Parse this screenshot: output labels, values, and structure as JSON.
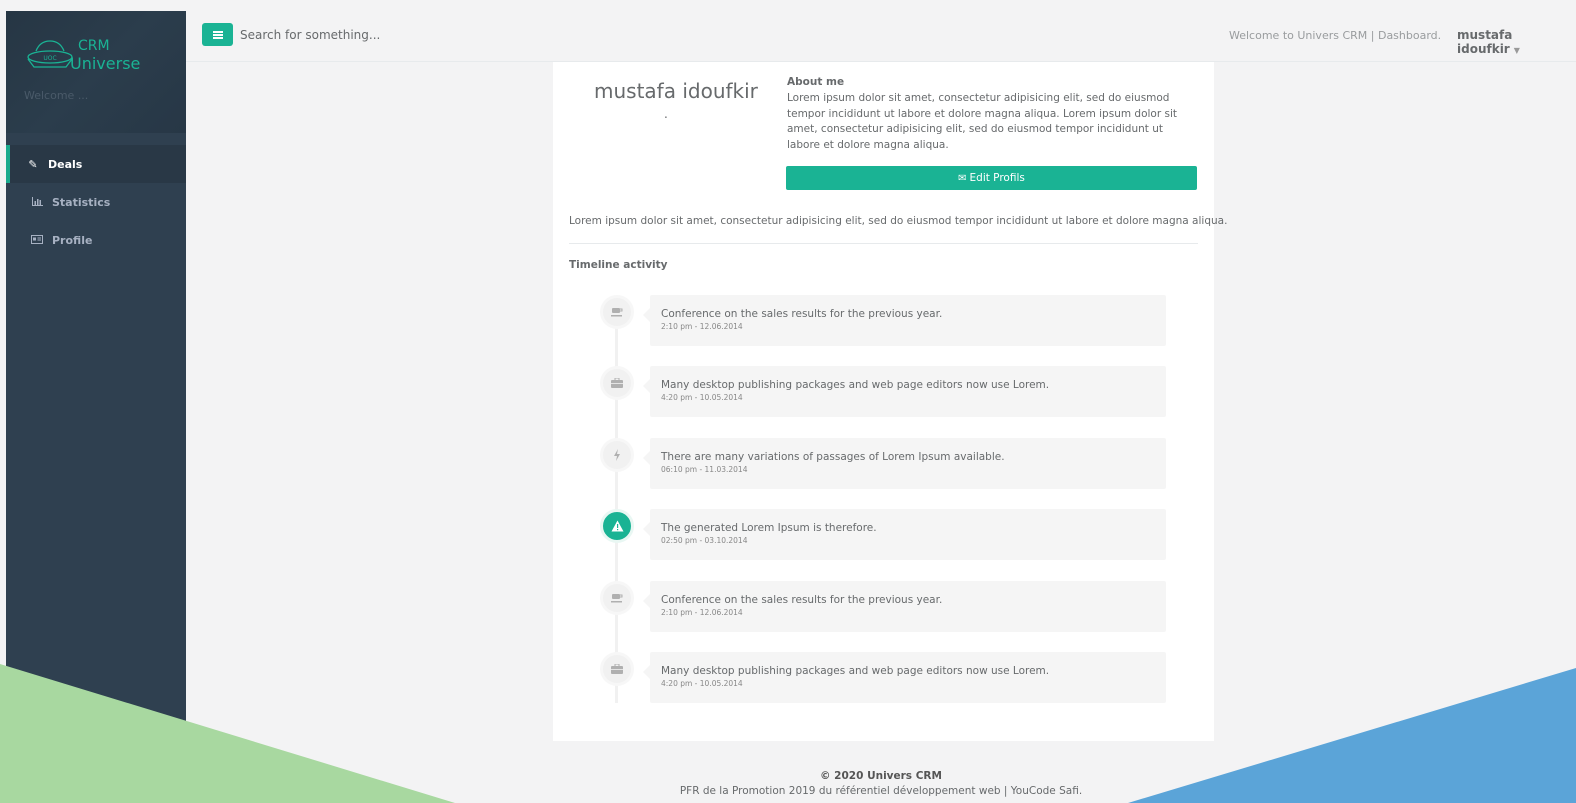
{
  "brand": {
    "name_line1": "CRM",
    "name_line2": "Universe",
    "logo_badge": "UOC",
    "welcome": "Welcome ..."
  },
  "sidebar": {
    "items": [
      {
        "label": "Deals",
        "icon": "edit-icon",
        "active": true
      },
      {
        "label": "Statistics",
        "icon": "bar-chart-icon",
        "active": false
      },
      {
        "label": "Profile",
        "icon": "id-card-icon",
        "active": false
      }
    ]
  },
  "topbar": {
    "search_placeholder": "Search for something...",
    "welcome_message": "Welcome to Univers CRM | Dashboard.",
    "user_name": "mustafa idoufkir"
  },
  "profile": {
    "name": "mustafa idoufkir",
    "subtitle": ".",
    "about_title": "About me",
    "about_text": "Lorem ipsum dolor sit amet, consectetur adipisicing elit, sed do eiusmod tempor incididunt ut labore et dolore magna aliqua. Lorem ipsum dolor sit amet, consectetur adipisicing elit, sed do eiusmod tempor incididunt ut labore et dolore magna aliqua.",
    "edit_button": "Edit Profils",
    "bio": "Lorem ipsum dolor sit amet, consectetur adipisicing elit, sed do eiusmod tempor incididunt ut labore et dolore magna aliqua."
  },
  "timeline": {
    "title": "Timeline activity",
    "items": [
      {
        "text": "Conference on the sales results for the previous year.",
        "time": "2:10 pm - 12.06.2014",
        "icon": "coffee-icon"
      },
      {
        "text": "Many desktop publishing packages and web page editors now use Lorem.",
        "time": "4:20 pm - 10.05.2014",
        "icon": "briefcase-icon"
      },
      {
        "text": "There are many variations of passages of Lorem Ipsum available.",
        "time": "06:10 pm - 11.03.2014",
        "icon": "bolt-icon"
      },
      {
        "text": "The generated Lorem Ipsum is therefore.",
        "time": "02:50 pm - 03.10.2014",
        "icon": "warning-icon"
      },
      {
        "text": "Conference on the sales results for the previous year.",
        "time": "2:10 pm - 12.06.2014",
        "icon": "coffee-icon"
      },
      {
        "text": "Many desktop publishing packages and web page editors now use Lorem.",
        "time": "4:20 pm - 10.05.2014",
        "icon": "briefcase-icon"
      }
    ]
  },
  "footer": {
    "copyright": "© 2020 Univers CRM",
    "credits": "PFR de la Promotion 2019 du référentiel développement web | YouCode Safi."
  },
  "colors": {
    "accent": "#1ab394",
    "sidebar": "#2f4050",
    "deco_green": "#a8d8a0",
    "deco_blue": "#5ba4d8"
  }
}
